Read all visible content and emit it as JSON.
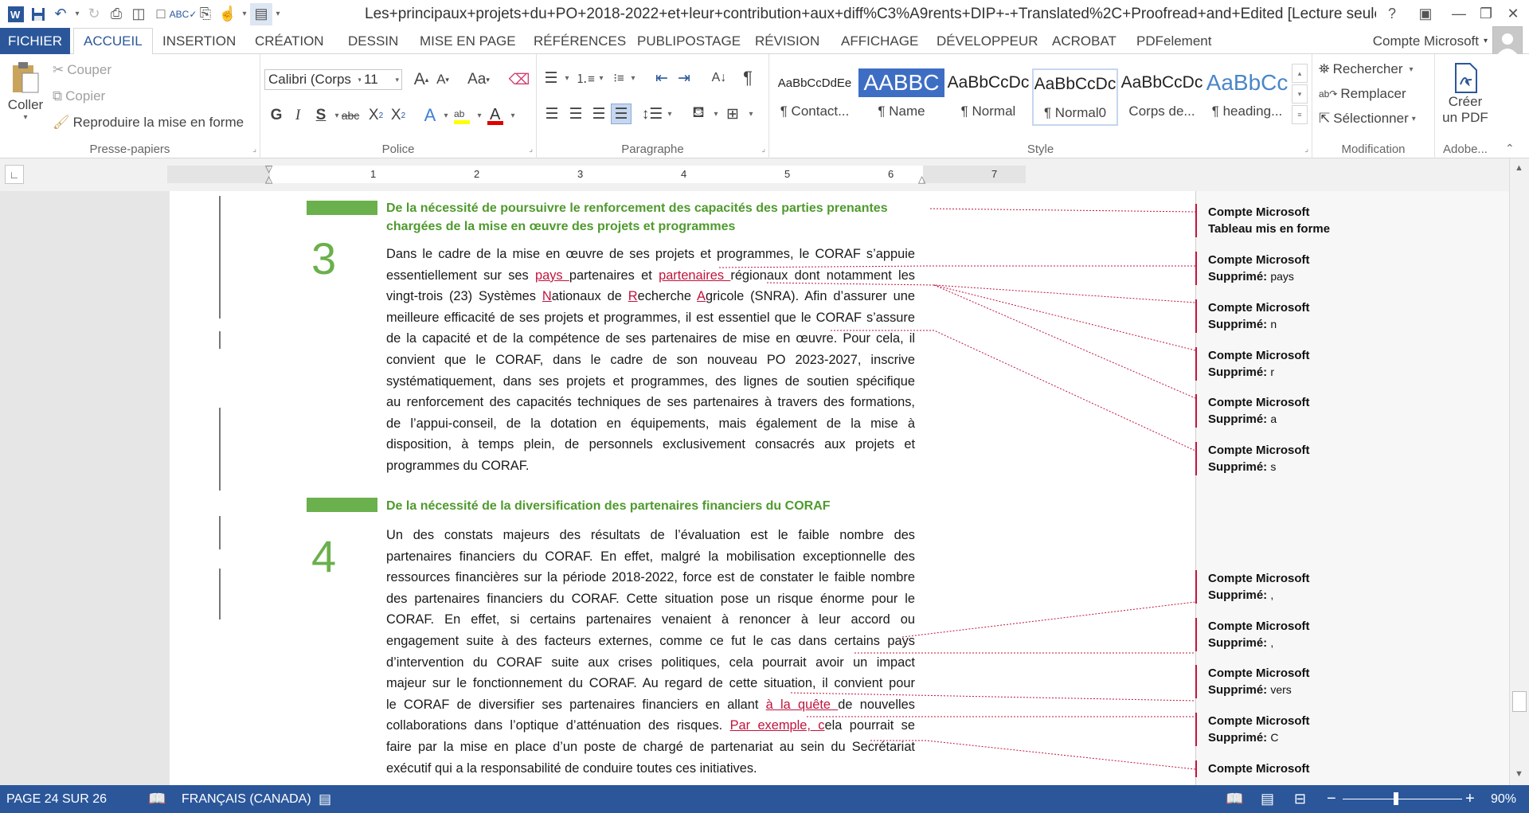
{
  "window": {
    "title": "Les+principaux+projets+du+PO+2018-2022+et+leur+contribution+aux+diff%C3%A9rents+DIP+-+Translated%2C+Proofread+and+Edited [Lecture seule] - W..."
  },
  "tabs": {
    "file": "FICHIER",
    "items": [
      "ACCUEIL",
      "INSERTION",
      "CRÉATION",
      "DESSIN",
      "MISE EN PAGE",
      "RÉFÉRENCES",
      "PUBLIPOSTAGE",
      "RÉVISION",
      "AFFICHAGE",
      "DÉVELOPPEUR",
      "ACROBAT",
      "PDFelement"
    ],
    "account": "Compte Microsoft"
  },
  "clipboard": {
    "paste": "Coller",
    "cut": "Couper",
    "copy": "Copier",
    "format_painter": "Reproduire la mise en forme",
    "label": "Presse-papiers"
  },
  "font": {
    "name": "Calibri (Corps",
    "size": "11",
    "label": "Police",
    "bold": "G",
    "italic": "I",
    "underline": "S",
    "strike": "abc",
    "sub": "X",
    "sup": "X",
    "aa": "Aa"
  },
  "paragraph": {
    "label": "Paragraphe"
  },
  "styles": {
    "label": "Style",
    "items": [
      {
        "preview": "AaBbCcDdEe",
        "name": "¶ Contact..."
      },
      {
        "preview": "AABBC",
        "name": "¶ Name"
      },
      {
        "preview": "AaBbCcDc",
        "name": "¶ Normal"
      },
      {
        "preview": "AaBbCcDc",
        "name": "¶ Normal0"
      },
      {
        "preview": "AaBbCcDc",
        "name": "Corps de..."
      },
      {
        "preview": "AaBbCc",
        "name": "¶ heading..."
      }
    ]
  },
  "editing": {
    "label": "Modification",
    "find": "Rechercher",
    "replace": "Remplacer",
    "select": "Sélectionner"
  },
  "adobe": {
    "label": "Adobe...",
    "create_line1": "Créer",
    "create_line2": "un PDF"
  },
  "ruler": {
    "numbers": [
      "1",
      "2",
      "3",
      "4",
      "5",
      "6",
      "7"
    ]
  },
  "document": {
    "sec3": {
      "number": "3",
      "heading1": "De la nécessité de poursuivre le renforcement des capacités des parties prenantes",
      "heading2": "chargées de la mise en œuvre des projets et programmes",
      "l1": "Dans le cadre de la mise en œuvre de ses projets et programmes, le CORAF s’appuie",
      "l2a": "essentiellement sur ses ",
      "l2b": "pays ",
      "l2c": "partenaires et ",
      "l2d": "partenaires ",
      "l2e": "régionaux dont notamment les",
      "l3a": "vingt-trois (23) Systèmes ",
      "l3b": "N",
      "l3c": "ationaux de ",
      "l3d": "R",
      "l3e": "echerche ",
      "l3f": "A",
      "l3g": "gricole (SNRA). Afin d’assurer une",
      "l4": "meilleure efficacité de ses projets et programmes, il est essentiel que le CORAF s’assure",
      "l5": "de la capacité et de la compétence de ses partenaires de mise en œuvre. Pour cela, il",
      "l6": "convient que le CORAF, dans le cadre de son nouveau PO 2023-2027, inscrive",
      "l7": "systématiquement, dans ses projets et programmes, des lignes de soutien spécifique",
      "l8": "au renforcement des capacités techniques de ses partenaires à travers des formations,",
      "l9": "de l’appui-conseil, de la dotation en équipements, mais également de la mise à",
      "l10": "disposition, à temps plein, de personnels exclusivement consacrés aux projets et",
      "l11": "programmes du CORAF."
    },
    "sec4": {
      "number": "4",
      "heading": "De la nécessité de la diversification des partenaires financiers du CORAF",
      "l1": "Un des constats majeurs des résultats de l’évaluation est le faible nombre des",
      "l2": "partenaires financiers du CORAF. En effet, malgré la mobilisation exceptionnelle des",
      "l3": "ressources financières sur la période 2018-2022, force est de constater le faible nombre",
      "l4": "des partenaires financiers du CORAF. Cette situation pose un risque énorme pour le",
      "l5": "CORAF. En effet, si certains partenaires venaient à renoncer à leur accord ou",
      "l6": "engagement suite à des facteurs externes, comme ce fut le cas dans certains pays",
      "l7": "d’intervention du CORAF suite aux crises politiques, cela pourrait avoir un impact",
      "l8": "majeur sur le fonctionnement du CORAF. Au regard de cette situation, il convient pour",
      "l9a": "le CORAF de diversifier ses partenaires financiers en allant ",
      "l9b": "à la quête ",
      "l9c": "de nouvelles",
      "l10a": "collaborations dans l’optique d’atténuation des risques. ",
      "l10b": "Par exemple, c",
      "l10c": "ela pourrait se",
      "l11": "faire par la mise en place d’un poste de chargé de partenariat au sein du Secrétariat",
      "l12": "exécutif qui a la responsabilité de conduire toutes ces initiatives."
    }
  },
  "comments": [
    {
      "author": "Compte Microsoft",
      "line2": "Tableau mis en forme",
      "kind": "",
      "text": ""
    },
    {
      "author": "Compte Microsoft",
      "line2": "",
      "kind": "Supprimé:",
      "text": "pays"
    },
    {
      "author": "Compte Microsoft",
      "line2": "",
      "kind": "Supprimé:",
      "text": "n"
    },
    {
      "author": "Compte Microsoft",
      "line2": "",
      "kind": "Supprimé:",
      "text": "r"
    },
    {
      "author": "Compte Microsoft",
      "line2": "",
      "kind": "Supprimé:",
      "text": "a"
    },
    {
      "author": "Compte Microsoft",
      "line2": "",
      "kind": "Supprimé:",
      "text": "s"
    },
    {
      "author": "Compte Microsoft",
      "line2": "",
      "kind": "Supprimé:",
      "text": ","
    },
    {
      "author": "Compte Microsoft",
      "line2": "",
      "kind": "Supprimé:",
      "text": ","
    },
    {
      "author": "Compte Microsoft",
      "line2": "",
      "kind": "Supprimé:",
      "text": "vers"
    },
    {
      "author": "Compte Microsoft",
      "line2": "",
      "kind": "Supprimé:",
      "text": "C"
    },
    {
      "author": "Compte Microsoft",
      "line2": "",
      "kind": "",
      "text": ""
    }
  ],
  "status": {
    "page": "PAGE 24 SUR 26",
    "language": "FRANÇAIS (CANADA)",
    "zoom": "90%",
    "zoom_level": 0.9
  },
  "colors": {
    "accent": "#2b579a",
    "revision": "#c0143c",
    "heading_green": "#4f9a2e",
    "number_green": "#6ab04c"
  }
}
